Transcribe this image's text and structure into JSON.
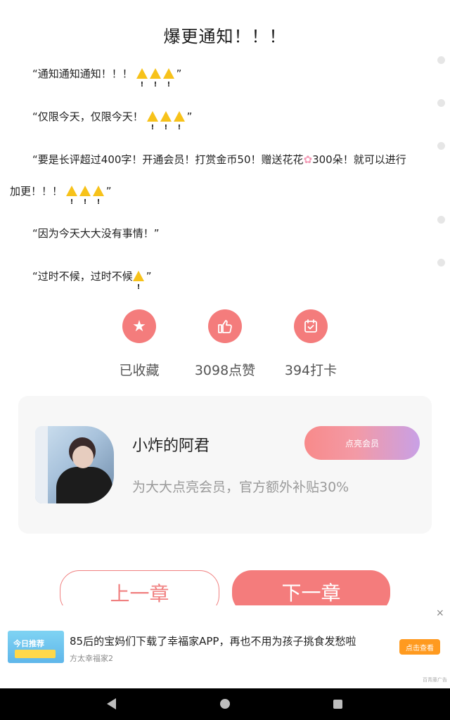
{
  "article": {
    "title": "爆更通知！！！",
    "lines": [
      "“通知通知通知！！！",
      "”",
      "“仅限今天，仅限今天！",
      "”",
      "“要是长评超过400字！开通会员！打赏金币50！赠送花花",
      "300朵！就可以进行",
      "加更！！！",
      "”",
      "“因为今天大大没有事情！”",
      "“过时不候，过时不候",
      "”"
    ],
    "flower_icon": "cherry-blossom-icon",
    "warning_icon": "warning-icon"
  },
  "actions": {
    "collect_label": "已收藏",
    "like_label": "3098点赞",
    "checkin_label": "394打卡"
  },
  "author_card": {
    "name": "小炸的阿君",
    "subtitle": "为大大点亮会员，官方额外补贴30%",
    "vip_button": "点亮会员"
  },
  "nav": {
    "prev": "上一章",
    "next": "下一章"
  },
  "ad": {
    "thumb_title": "今日推荐",
    "text": "85后的宝妈们下载了幸福家APP，再也不用为孩子挑食发愁啦",
    "source": "方太幸福家2",
    "cta": "点击查看",
    "tag": "百青藤广告",
    "close": "×"
  },
  "colors": {
    "accent": "#f47c7c",
    "card_bg": "#f7f7f7",
    "ad_cta": "#ff9a1f"
  }
}
